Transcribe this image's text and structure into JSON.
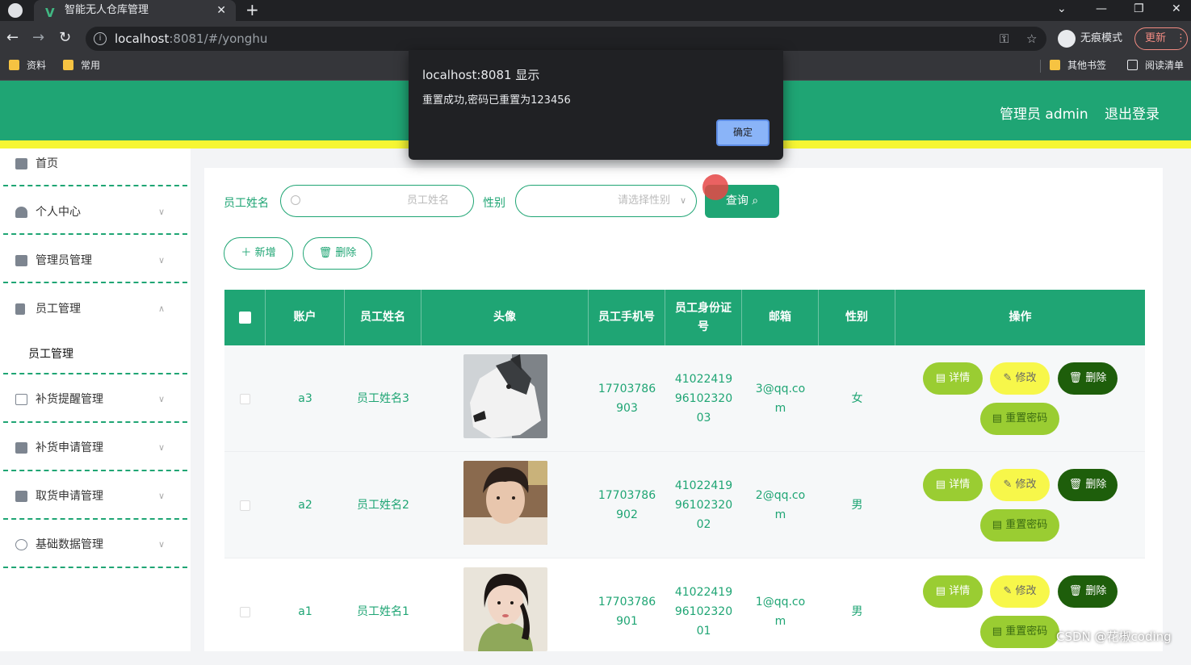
{
  "browser": {
    "tab_title": "智能无人仓库管理",
    "tab_close": "✕",
    "new_tab": "+",
    "url_host": "localhost",
    "url_rest": ":8081/#/yonghu",
    "incognito_label": "无痕模式",
    "update_label": "更新",
    "window_controls": [
      "⌄",
      "—",
      "❐",
      "✕"
    ],
    "bookmarks": [
      "资料",
      "常用"
    ],
    "other_bookmarks": "其他书签",
    "reading_list": "阅读清单"
  },
  "dialog": {
    "title": "localhost:8081 显示",
    "message": "重置成功,密码已重置为123456",
    "ok_label": "确定"
  },
  "header": {
    "user_label": "管理员 admin",
    "logout_label": "退出登录",
    "colors": {
      "primary": "#1fa574",
      "stripe": "#f6f633"
    }
  },
  "sidebar": {
    "items": [
      {
        "label": "首页",
        "icon": "home-icon",
        "expandable": false
      },
      {
        "label": "个人中心",
        "icon": "user-icon",
        "expandable": true
      },
      {
        "label": "管理员管理",
        "icon": "briefcase-icon",
        "expandable": true
      },
      {
        "label": "员工管理",
        "icon": "document-icon",
        "expandable": true,
        "expanded": true
      },
      {
        "label": "补货提醒管理",
        "icon": "copy-icon",
        "expandable": true
      },
      {
        "label": "补货申请管理",
        "icon": "monitor-icon",
        "expandable": true
      },
      {
        "label": "取货申请管理",
        "icon": "books-icon",
        "expandable": true
      },
      {
        "label": "基础数据管理",
        "icon": "clock-icon",
        "expandable": true
      }
    ],
    "submenu_item": "员工管理"
  },
  "search": {
    "name_label": "员工姓名",
    "name_placeholder": "员工姓名",
    "gender_label": "性别",
    "gender_placeholder": "请选择性别",
    "query_label": "查询"
  },
  "toolbar": {
    "add_label": "新增",
    "delete_label": "删除"
  },
  "table": {
    "headers": [
      "账户",
      "员工姓名",
      "头像",
      "员工手机号",
      "员工身份证号",
      "邮箱",
      "性别",
      "操作"
    ],
    "id_header_lines": [
      "员工身份证",
      "号"
    ],
    "rows": [
      {
        "account": "a3",
        "name": "员工姓名3",
        "phone": [
          "17703786",
          "903"
        ],
        "id_card": [
          "41022419",
          "96102320",
          "03"
        ],
        "email": [
          "3@qq.co",
          "m"
        ],
        "gender": "女",
        "avatar": "husky-dog-photo"
      },
      {
        "account": "a2",
        "name": "员工姓名2",
        "phone": [
          "17703786",
          "902"
        ],
        "id_card": [
          "41022419",
          "96102320",
          "02"
        ],
        "email": [
          "2@qq.co",
          "m"
        ],
        "gender": "男",
        "avatar": "young-man-photo"
      },
      {
        "account": "a1",
        "name": "员工姓名1",
        "phone": [
          "17703786",
          "901"
        ],
        "id_card": [
          "41022419",
          "96102320",
          "01"
        ],
        "email": [
          "1@qq.co",
          "m"
        ],
        "gender": "男",
        "avatar": "young-woman-photo"
      }
    ],
    "actions": {
      "detail": "详情",
      "edit": "修改",
      "delete": "删除",
      "reset": "重置密码"
    }
  },
  "watermark": "CSDN @花椒coding"
}
